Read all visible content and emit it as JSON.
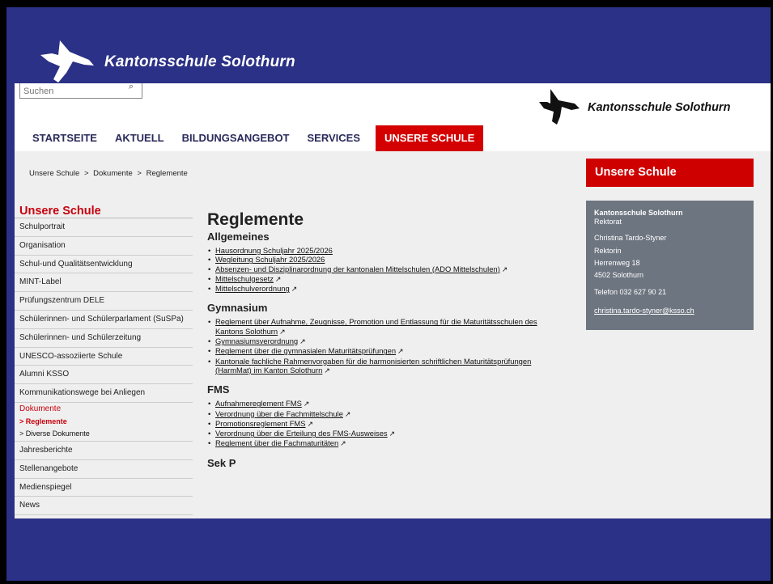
{
  "banner": {
    "title": "Kantonsschule Solothurn"
  },
  "search": {
    "placeholder": "Suchen"
  },
  "header": {
    "logo_text": "Kantonsschule Solothurn"
  },
  "nav": {
    "items": [
      "STARTSEITE",
      "AKTUELL",
      "BILDUNGSANGEBOT",
      "SERVICES",
      "UNSERE SCHULE"
    ],
    "active": "UNSERE SCHULE"
  },
  "breadcrumb": [
    "Unsere Schule",
    ">",
    "Dokumente",
    ">",
    "Reglemente"
  ],
  "sidebar": {
    "title": "Unsere Schule",
    "items": [
      "Schulportrait",
      "Organisation",
      "Schul-und Qualitätsentwicklung",
      "MINT-Label",
      "Prüfungszentrum DELE",
      "Schülerinnen- und Schülerparlament (SuSPa)",
      "Schülerinnen- und Schülerzeitung",
      "UNESCO-assoziierte Schule",
      "Alumni KSSO",
      "Kommunikationswege bei Anliegen"
    ],
    "active_item": "Dokumente",
    "sub_items": [
      "> Reglemente",
      "> Diverse Dokumente"
    ],
    "items_after": [
      "Jahresberichte",
      "Stellenangebote",
      "Medienspiegel",
      "News"
    ]
  },
  "main": {
    "title": "Reglemente",
    "sections": [
      {
        "heading": "Allgemeines",
        "links": [
          {
            "text": "Hausordnung Schuljahr 2025/2026",
            "ext": false
          },
          {
            "text": "Wegleitung Schuljahr 2025/2026",
            "ext": false
          },
          {
            "text": "Absenzen- und Disziplinarordnung der kantonalen Mittelschulen (ADO Mittelschulen)",
            "ext": true
          },
          {
            "text": "Mittelschulgesetz",
            "ext": true
          },
          {
            "text": "Mittelschulverordnung",
            "ext": true
          }
        ]
      },
      {
        "heading": "Gymnasium",
        "links": [
          {
            "text": "Reglement über Aufnahme, Zeugnisse, Promotion und Entlassung für die Maturitätsschulen des Kantons Solothurn",
            "ext": true
          },
          {
            "text": "Gymnasiumsverordnung",
            "ext": true
          },
          {
            "text": "Reglement über die gymnasialen Maturitätsprüfungen",
            "ext": true
          },
          {
            "text": "Kantonale fachliche Rahmenvorgaben für die harmonisierten schriftlichen Maturitätsprüfungen (HarmMat) im Kanton Solothurn",
            "ext": true
          }
        ]
      },
      {
        "heading": "FMS",
        "links": [
          {
            "text": "Aufnahmereglement FMS",
            "ext": true
          },
          {
            "text": "Verordnung über die Fachmittelschule",
            "ext": true
          },
          {
            "text": "Promotionsreglement FMS",
            "ext": true
          },
          {
            "text": "Verordnung über die Erteilung des FMS-Ausweises",
            "ext": true
          },
          {
            "text": "Reglement über die Fachmaturitäten",
            "ext": true
          }
        ]
      },
      {
        "heading": "Sek P",
        "links": []
      }
    ]
  },
  "aside": {
    "title": "Unsere Schule",
    "contact": {
      "org": "Kantonsschule Solothurn",
      "dept": "Rektorat",
      "name": "Christina Tardo-Styner",
      "role": "Rektorin",
      "street": "Herrenweg 18",
      "city": "4502 Solothurn",
      "phone": "Telefon 032 627 90 21",
      "email": "christina.tardo-styner@ksso.ch"
    }
  },
  "colors": {
    "brand_red": "#cf0000",
    "frame_blue": "#2b3186",
    "aside_grey": "#6d7580"
  }
}
